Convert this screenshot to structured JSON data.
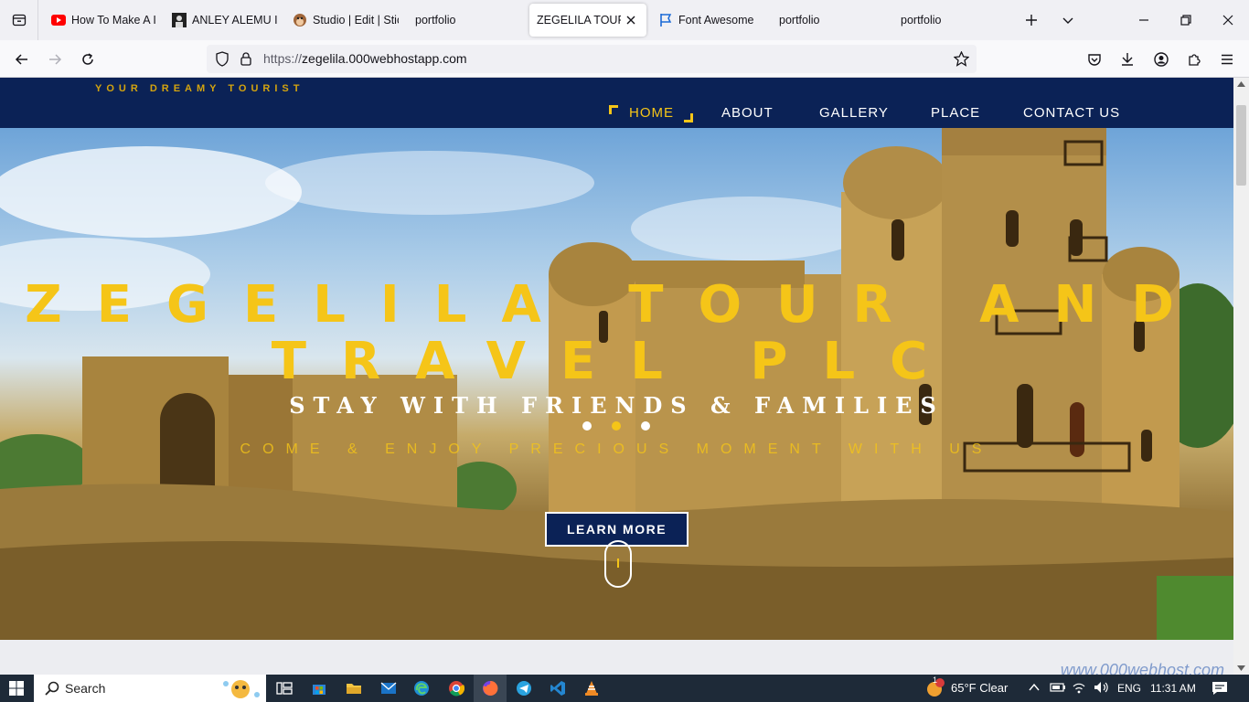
{
  "browser": {
    "tabs": [
      {
        "title": "How To Make A I",
        "icon": "youtube-icon"
      },
      {
        "title": "ANLEY ALEMU IN",
        "icon": "profile-icon"
      },
      {
        "title": "Studio | Edit | Stic",
        "icon": "monkey-icon"
      },
      {
        "title": "portfolio",
        "icon": "none"
      },
      {
        "title": "ZEGELILA TOUR AN",
        "icon": "none",
        "active": true
      },
      {
        "title": "Font Awesome",
        "icon": "flag-icon"
      },
      {
        "title": "portfolio",
        "icon": "none"
      },
      {
        "title": "portfolio",
        "icon": "none"
      }
    ],
    "url_scheme": "https://",
    "url_host": "zegelila.000webhostapp.com"
  },
  "site": {
    "brand_tag": "YOUR DREAMY TOURIST",
    "menu": [
      "HOME",
      "ABOUT",
      "GALLERY",
      "PLACE",
      "CONTACT US"
    ],
    "hero_title_line1": "ZEGELILA TOUR AND",
    "hero_title_line2": "TRAVEL PLC",
    "hero_subtitle": "STAY WITH FRIENDS & FAMILIES",
    "hero_tagline": "COME & ENJOY PRECIOUS MOMENT WITH US",
    "cta": "LEARN MORE",
    "slide_count": 3,
    "active_slide": 2,
    "watermark": "www.000webhost.com"
  },
  "taskbar": {
    "search_label": "Search",
    "weather": "65°F  Clear",
    "weather_badge": "1",
    "lang": "ENG",
    "time": "11:31 AM"
  },
  "colors": {
    "accent": "#f5c518",
    "navy": "#0b2256"
  }
}
